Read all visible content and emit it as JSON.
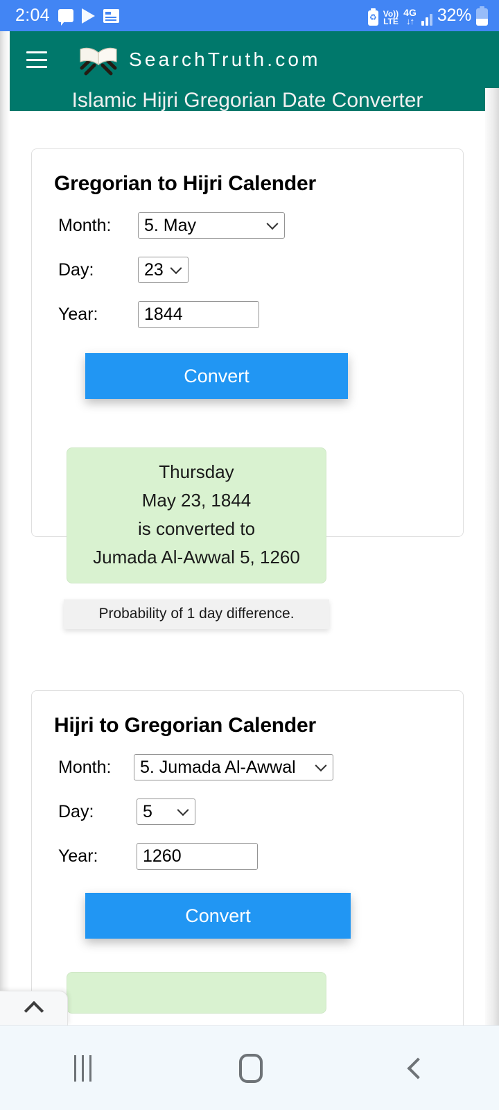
{
  "status_bar": {
    "time": "2:04",
    "icons_left": [
      "chat-bubble-icon",
      "play-store-icon",
      "news-icon"
    ],
    "battery_saver": "battery-saver-icon",
    "volte_top": "Vo))",
    "volte_bottom": "LTE",
    "network": "4G",
    "data_arrows": "↓↑",
    "signal": "signal-bars-icon",
    "battery_percent": "32%",
    "background_color": "#4285F4"
  },
  "header": {
    "menu_icon": "hamburger-menu-icon",
    "logo_icon": "quran-book-logo",
    "brand": "SearchTruth.com",
    "background_color": "#00786B"
  },
  "page_title": "Islamic Hijri Gregorian Date Converter",
  "cards": [
    {
      "title": "Gregorian to Hijri Calender",
      "fields": [
        {
          "label": "Month:",
          "type": "select",
          "value": "5. May"
        },
        {
          "label": "Day:",
          "type": "select",
          "value": "23"
        },
        {
          "label": "Year:",
          "type": "text",
          "value": "1844"
        }
      ],
      "button": "Convert",
      "result_lines": [
        "Thursday",
        "May 23, 1844",
        "is converted to",
        "Jumada Al-Awwal 5, 1260"
      ],
      "note": "Probability of 1 day difference."
    },
    {
      "title": "Hijri to Gregorian Calender",
      "fields": [
        {
          "label": "Month:",
          "type": "select",
          "value": "5. Jumada Al-Awwal"
        },
        {
          "label": "Day:",
          "type": "select",
          "value": "5"
        },
        {
          "label": "Year:",
          "type": "text",
          "value": "1260"
        }
      ],
      "button": "Convert"
    }
  ],
  "scroll_to_top": "chevron-up-icon",
  "nav_bar": {
    "recents": "recents-icon",
    "home": "home-icon",
    "back": "back-icon",
    "background_color": "#f2f8fc"
  },
  "colors": {
    "brand_green": "#00786B",
    "accent_blue": "#2196F3",
    "status_blue": "#4285F4",
    "result_green": "#d9f2d0"
  }
}
